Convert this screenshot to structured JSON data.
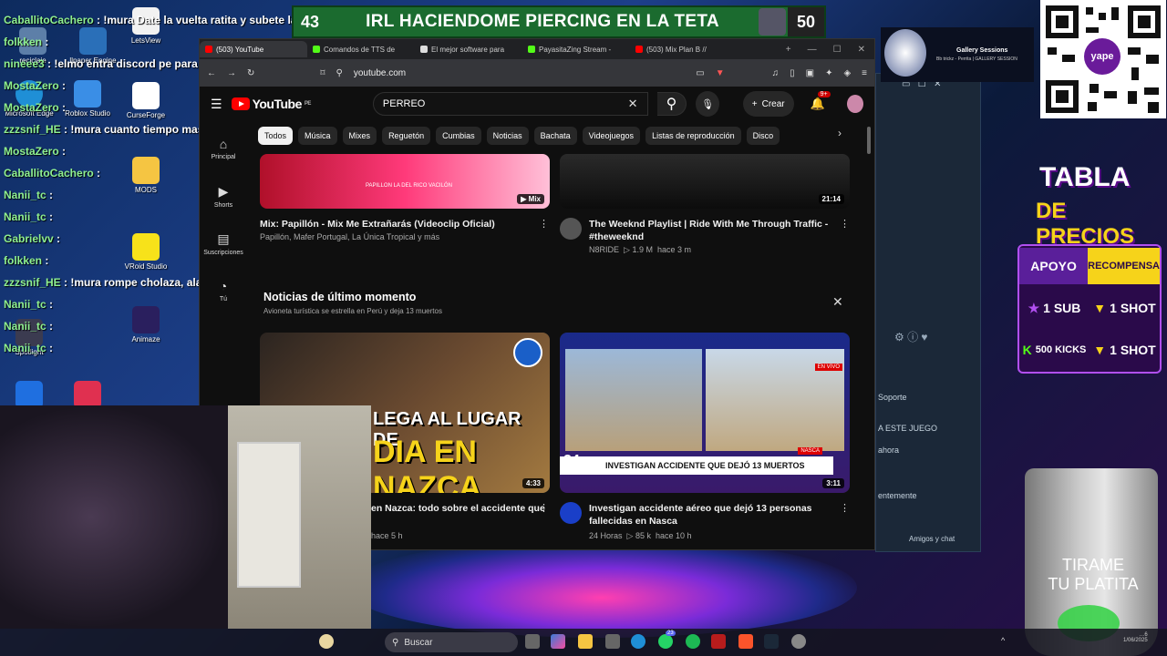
{
  "banner": {
    "left_number": "43",
    "title": "IRL HACIENDOME PIERCING EN LA TETA",
    "right_number": "50"
  },
  "chat": [
    {
      "user": "CaballitoCachero",
      "text": " : !mura Date la vuelta ratita y subete la"
    },
    {
      "user": "folkken",
      "text": " :"
    },
    {
      "user": "nineee3",
      "text": " : !elmo entra discord pe para donar"
    },
    {
      "user": "MostaZero",
      "text": " :"
    },
    {
      "user": "MostaZero",
      "text": " :"
    },
    {
      "user": "zzzsnif_HE",
      "text": " : !mura cuanto tiempo mas te quedas por esas 2 subs confirma"
    },
    {
      "user": "MostaZero",
      "text": " :"
    },
    {
      "user": "CaballitoCachero",
      "text": " :"
    },
    {
      "user": "Nanii_tc",
      "text": " :"
    },
    {
      "user": "Nanii_tc",
      "text": " :"
    },
    {
      "user": "Gabrielvv",
      "text": " :"
    },
    {
      "user": "folkken",
      "text": " :"
    },
    {
      "user": "zzzsnif_HE",
      "text": " : !mura rompe cholaza, alamos"
    },
    {
      "user": "Nanii_tc",
      "text": " :"
    },
    {
      "user": "Nanii_tc",
      "text": " :"
    },
    {
      "user": "Nanii_tc",
      "text": " :"
    }
  ],
  "desktop_icons": {
    "reciclaje": "reciclaje",
    "wallpaper": "llpaper Engine",
    "letsview": "LetsView",
    "edge": "Microsoft Edge",
    "roblox_studio": "Roblox Studio",
    "curseforge": "CurseForge",
    "mods": "MODS",
    "vroid": "VRoid Studio",
    "animaze": "Animaze",
    "spotlight": "Spotlight"
  },
  "browser": {
    "tabs": [
      "(503) YouTube",
      "Comandos de TTS de",
      "El mejor software para",
      "PayasitaZing Stream -",
      "(503) Mix Plan B //"
    ],
    "url": "youtube.com"
  },
  "youtube": {
    "logo": "YouTube",
    "logo_region": "PE",
    "search_value": "PERREO",
    "create_label": "Crear",
    "notif_badge": "9+",
    "sidebar": [
      {
        "icon": "home-icon",
        "label": "Principal"
      },
      {
        "icon": "shorts-icon",
        "label": "Shorts"
      },
      {
        "icon": "subscriptions-icon",
        "label": "Suscripciones"
      },
      {
        "icon": "you-icon",
        "label": "Tú"
      }
    ],
    "chips": [
      "Todos",
      "Música",
      "Mixes",
      "Reguetón",
      "Cumbias",
      "Noticias",
      "Bachata",
      "Videojuegos",
      "Listas de reproducción",
      "Disco"
    ],
    "videos": [
      {
        "title": "Mix: Papillón - Mix Me Extrañarás (Videoclip Oficial)",
        "meta": "Papillón, Mafer Portugal, La Única Tropical y más",
        "badge": "Mix",
        "thumb_text": "PAPILLON LA DEL RICO VACILÓN"
      },
      {
        "title": "The Weeknd Playlist | Ride With Me Through Traffic - #theweeknd",
        "channel": "N8RIDE",
        "views": "▷ 1.9 M",
        "age": "hace 3 m",
        "duration": "21:14"
      }
    ],
    "news": {
      "title": "Noticias de último momento",
      "subtitle": "Avioneta turística se estrella en Perú y deja 13 muertos",
      "items": [
        {
          "title": "en Nazca: todo sobre el accidente que",
          "age": "hace 5 h",
          "duration": "4:33",
          "thumb_text_1": "LEGA AL LUGAR DE",
          "thumb_text_2": "DIA EN NAZCA"
        },
        {
          "title": "Investigan accidente aéreo que dejó 13 personas fallecidas en Nasca",
          "channel": "24 Horas",
          "views": "▷ 85 k",
          "age": "hace 10 h",
          "duration": "3:11",
          "ticker": "INVESTIGAN ACCIDENTE QUE DEJÓ 13 MUERTOS",
          "live": "EN VIVO",
          "brand": "24",
          "brand_sub": "HORAS",
          "place": "NASCA"
        }
      ]
    }
  },
  "steam": {
    "soporte": "Soporte",
    "juego": "A ESTE JUEGO",
    "ahora": "ahora",
    "ente": "entemente",
    "amigos": "Amigos y chat"
  },
  "gallery": {
    "title": "Gallery Sessions",
    "subtitle": "Bb trickz - Perrita | GALLERY SESSION"
  },
  "yape": {
    "label": "yape"
  },
  "price_table": {
    "title1": "TABLA",
    "title2": "DE PRECIOS",
    "header_left": "APOYO",
    "header_right": "RECOMPENSA",
    "rows": [
      {
        "left": "1 SUB",
        "right": "1 SHOT"
      },
      {
        "left": "500 KICKS",
        "right": "1 SHOT"
      }
    ]
  },
  "glass": {
    "line1": "TIRAME",
    "line2": "TU PLATITA"
  },
  "taskbar": {
    "search_placeholder": "Buscar",
    "badge": "23"
  },
  "tray": {
    "time": "…6",
    "date": "1/06/2025"
  },
  "colors": {
    "youtube_red": "#ff0000",
    "chat_user": "#8ff08f",
    "banner_green": "#1b6b2f",
    "price_gold": "#f6d31a"
  }
}
